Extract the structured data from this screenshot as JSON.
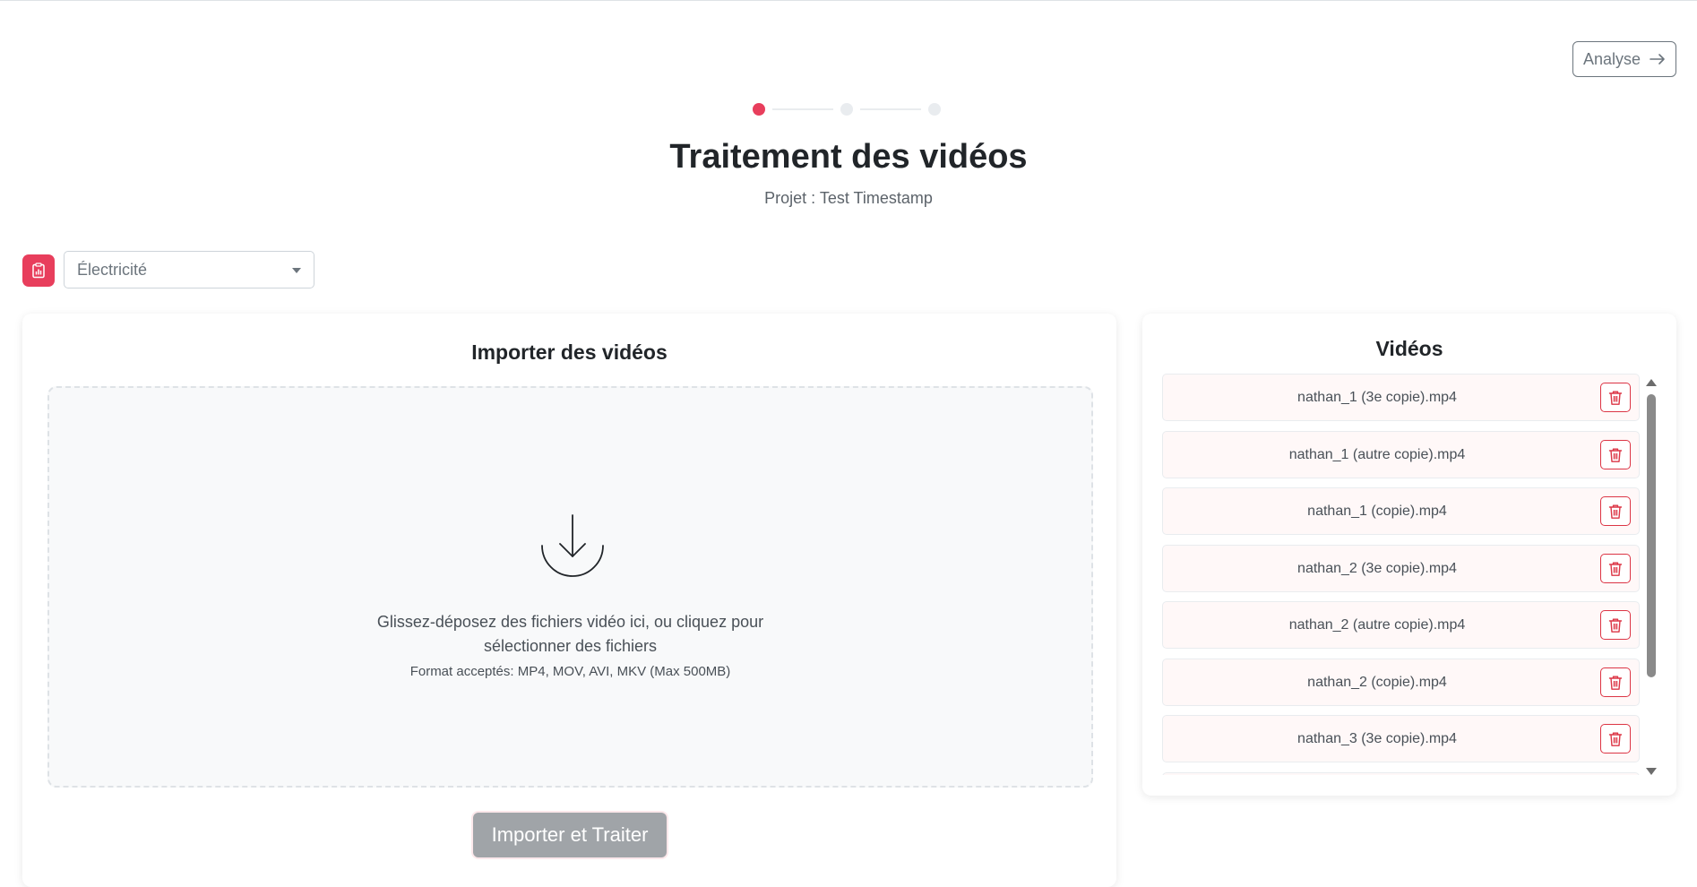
{
  "header": {
    "analyse_label": "Analyse",
    "arrow_icon": "arrow-right-icon"
  },
  "stepper": {
    "steps_total": 3,
    "active_step": 1,
    "active_color": "#e83e5c",
    "inactive_color": "#e9ecef"
  },
  "page": {
    "title": "Traitement des vidéos",
    "subtitle": "Projet : Test Timestamp"
  },
  "category": {
    "icon": "clipboard-chart-icon",
    "icon_color": "#e83e5c",
    "selected": "Électricité"
  },
  "upload": {
    "title": "Importer des vidéos",
    "icon": "download-icon",
    "drop_text_line1": "Glissez-déposez des fichiers vidéo ici, ou cliquez pour",
    "drop_text_line2": "sélectionner des fichiers",
    "formats_hint": "Format acceptés: MP4, MOV, AVI, MKV (Max 500MB)",
    "submit_label": "Importer et Traiter"
  },
  "videos": {
    "title": "Vidéos",
    "delete_icon": "trash-icon",
    "items": [
      {
        "name": "nathan_1 (3e copie).mp4"
      },
      {
        "name": "nathan_1 (autre copie).mp4"
      },
      {
        "name": "nathan_1 (copie).mp4"
      },
      {
        "name": "nathan_2 (3e copie).mp4"
      },
      {
        "name": "nathan_2 (autre copie).mp4"
      },
      {
        "name": "nathan_2 (copie).mp4"
      },
      {
        "name": "nathan_3 (3e copie).mp4"
      },
      {
        "name": ""
      }
    ]
  }
}
